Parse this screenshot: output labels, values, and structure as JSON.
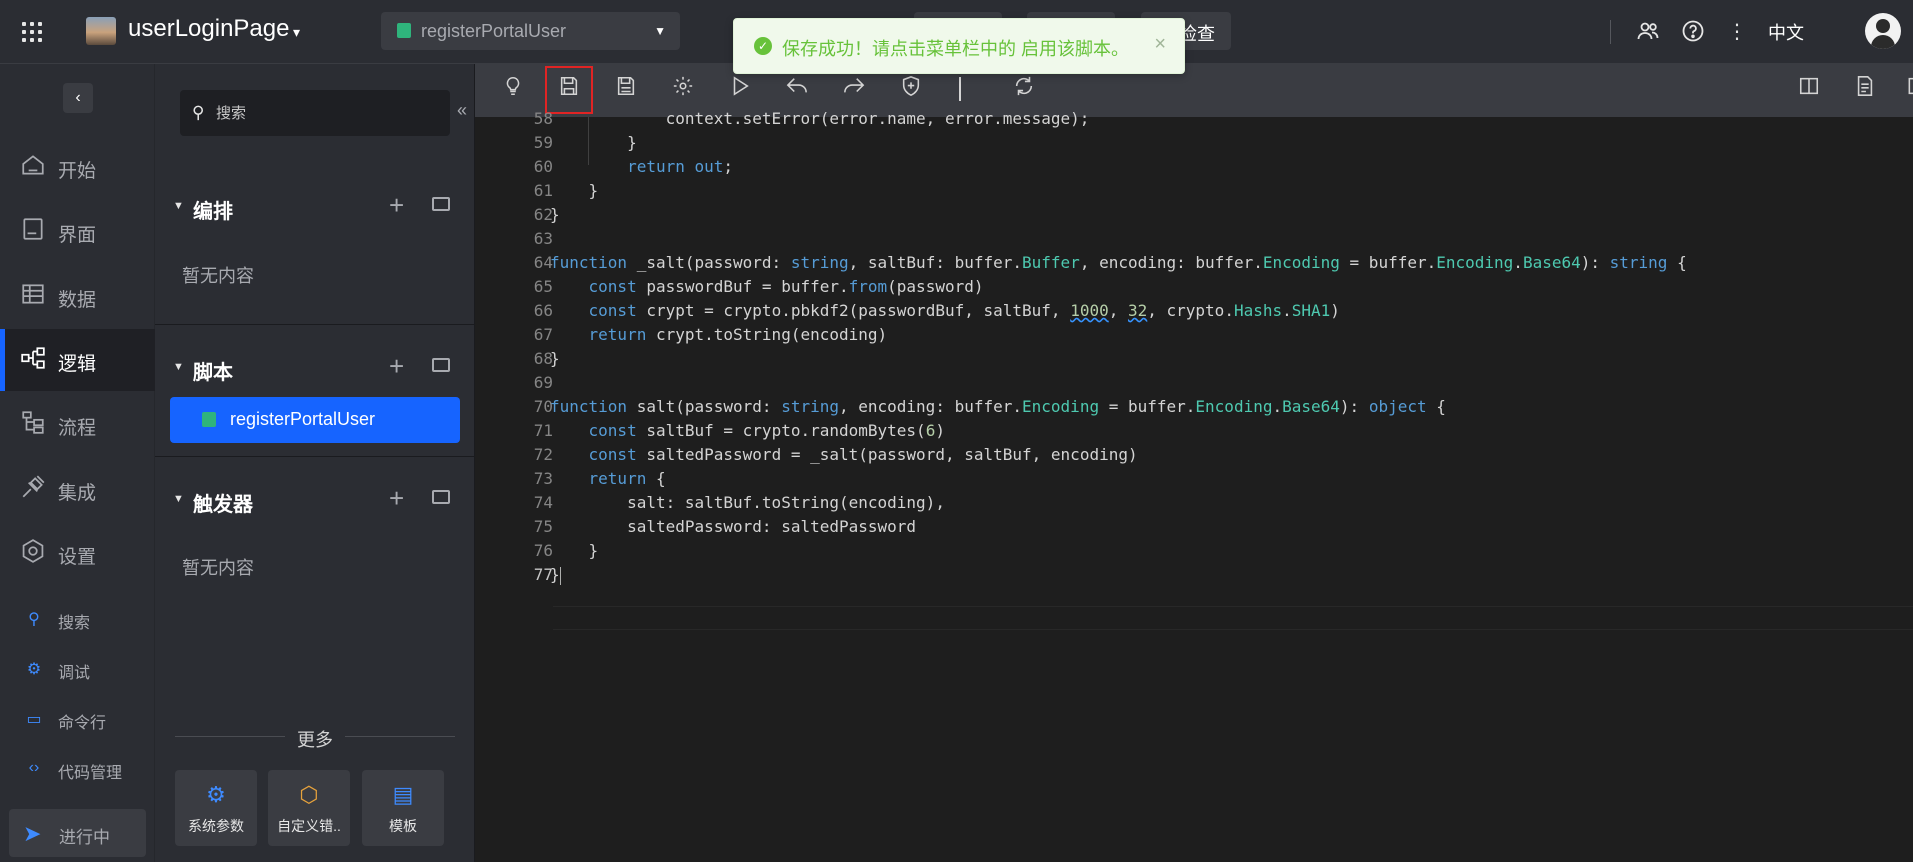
{
  "header": {
    "project_name": "userLoginPage",
    "script_select": "registerPortalUser",
    "check_label": "检查",
    "lang": "中文"
  },
  "toast": {
    "message": "保存成功！请点击菜单栏中的 启用该脚本。",
    "type": "success"
  },
  "nav": {
    "items": [
      {
        "label": "开始",
        "icon": "home-icon"
      },
      {
        "label": "界面",
        "icon": "page-icon"
      },
      {
        "label": "数据",
        "icon": "table-icon"
      },
      {
        "label": "逻辑",
        "icon": "logic-icon",
        "active": true
      },
      {
        "label": "流程",
        "icon": "flow-icon"
      },
      {
        "label": "集成",
        "icon": "plug-icon"
      },
      {
        "label": "设置",
        "icon": "settings-icon"
      }
    ],
    "small_items": [
      {
        "label": "搜索",
        "icon": "search-icon"
      },
      {
        "label": "调试",
        "icon": "debug-icon"
      },
      {
        "label": "命令行",
        "icon": "terminal-icon"
      },
      {
        "label": "代码管理",
        "icon": "code-icon"
      }
    ],
    "running_label": "进行中"
  },
  "panel": {
    "search_placeholder": "搜索",
    "sections": [
      {
        "title": "编排",
        "empty": "暂无内容"
      },
      {
        "title": "脚本",
        "items": [
          "registerPortalUser"
        ]
      },
      {
        "title": "触发器",
        "empty": "暂无内容"
      }
    ],
    "more_label": "更多",
    "tools": [
      {
        "label": "系统参数",
        "icon": "gear-icon"
      },
      {
        "label": "自定义错..",
        "icon": "cube-icon"
      },
      {
        "label": "模板",
        "icon": "template-icon"
      }
    ]
  },
  "colors": {
    "accent": "#1664ff",
    "success": "#67c23a",
    "highlight_border": "#e02424"
  },
  "toolbar": {
    "icons": [
      "bulb-icon",
      "save-icon",
      "save-as-icon",
      "gear-icon",
      "run-icon",
      "undo-icon",
      "redo-icon",
      "shield-icon",
      "refresh-icon"
    ],
    "highlighted": "save-icon"
  },
  "code": {
    "lines": [
      {
        "n": "58",
        "text": "            context.setError(error.name, error.message);"
      },
      {
        "n": "59",
        "text": "        }"
      },
      {
        "n": "60",
        "text": "        return out;"
      },
      {
        "n": "61",
        "text": "    }"
      },
      {
        "n": "62",
        "text": "}"
      },
      {
        "n": "63",
        "text": ""
      },
      {
        "n": "64",
        "text": "function _salt(password: string, saltBuf: buffer.Buffer, encoding: buffer.Encoding = buffer.Encoding.Base64): string {"
      },
      {
        "n": "65",
        "text": "    const passwordBuf = buffer.from(password)"
      },
      {
        "n": "66",
        "text": "    const crypt = crypto.pbkdf2(passwordBuf, saltBuf, 1000, 32, crypto.Hashs.SHA1)"
      },
      {
        "n": "67",
        "text": "    return crypt.toString(encoding)"
      },
      {
        "n": "68",
        "text": "}"
      },
      {
        "n": "69",
        "text": ""
      },
      {
        "n": "70",
        "text": "function salt(password: string, encoding: buffer.Encoding = buffer.Encoding.Base64): object {"
      },
      {
        "n": "71",
        "text": "    const saltBuf = crypto.randomBytes(6)"
      },
      {
        "n": "72",
        "text": "    const saltedPassword = _salt(password, saltBuf, encoding)"
      },
      {
        "n": "73",
        "text": "    return {"
      },
      {
        "n": "74",
        "text": "        salt: saltBuf.toString(encoding),"
      },
      {
        "n": "75",
        "text": "        saltedPassword: saltedPassword"
      },
      {
        "n": "76",
        "text": "    }"
      },
      {
        "n": "77",
        "text": "}"
      }
    ]
  }
}
